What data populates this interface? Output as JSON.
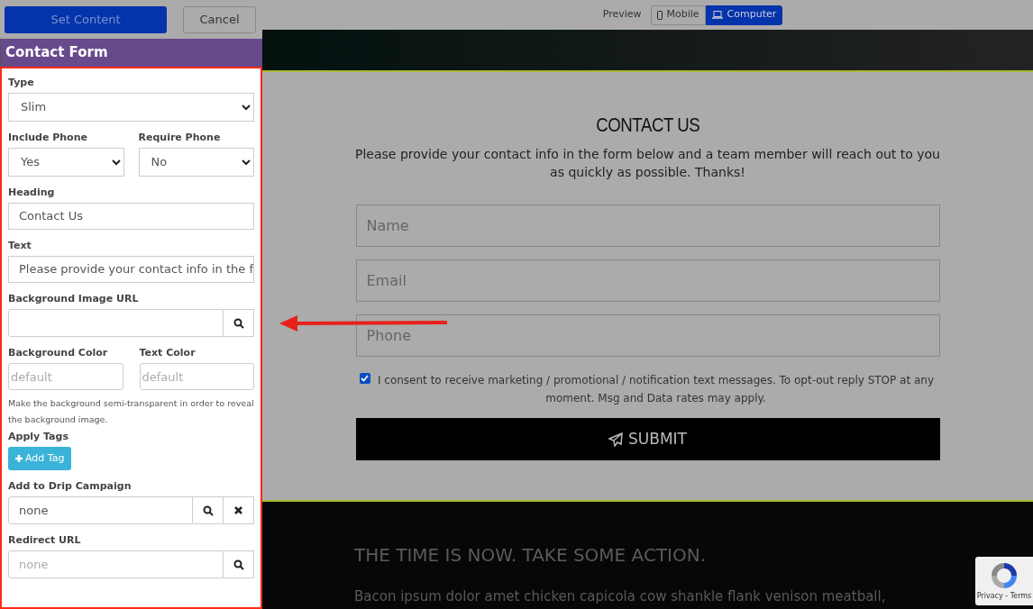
{
  "toolbar": {
    "primary_button": "Set Content",
    "cancel_button": "Cancel"
  },
  "panel": {
    "title": "Contact Form",
    "fields": [
      {
        "kind": "select",
        "label": "Type",
        "value": "Slim"
      },
      {
        "kind": "select_pair",
        "items": [
          {
            "label": "Include Phone",
            "value": "Yes"
          },
          {
            "label": "Require Phone",
            "value": "No"
          }
        ]
      },
      {
        "kind": "text",
        "label": "Heading",
        "value": "Contact Us"
      },
      {
        "kind": "text",
        "label": "Text",
        "value": "Please provide your contact info in the f"
      },
      {
        "kind": "search",
        "label": "Background Image URL"
      },
      {
        "kind": "text_pair",
        "items": [
          {
            "label": "Background Color",
            "placeholder": "default"
          },
          {
            "label": "Text Color",
            "placeholder": "default"
          }
        ]
      },
      {
        "kind": "note",
        "text": "Make the background semi-transparent in order to reveal the background image."
      },
      {
        "kind": "tags",
        "label": "Apply Tags",
        "button": "Add Tag"
      },
      {
        "kind": "search_clear",
        "label": "Add to Drip Campaign",
        "value": "none"
      },
      {
        "kind": "search",
        "label": "Redirect URL",
        "placeholder": "none"
      }
    ]
  },
  "preview": {
    "label": "Preview",
    "modes": [
      {
        "label": "Mobile",
        "kind": "mobile",
        "selected": false
      },
      {
        "label": "Computer",
        "kind": "computer",
        "selected": true
      }
    ],
    "form": {
      "heading": "CONTACT US",
      "text": "Please provide your contact info in the form below and a team member will reach out to you as quickly as possible. Thanks!",
      "inputs": [
        {
          "placeholder": "Name"
        },
        {
          "placeholder": "Email"
        },
        {
          "placeholder": "Phone"
        }
      ],
      "consent": {
        "checked": true,
        "text": "I consent to receive marketing / promotional / notification text messages. To opt-out reply STOP at any moment. Msg and Data rates may apply."
      },
      "submit": "SUBMIT"
    },
    "next_section": {
      "heading": "THE TIME IS NOW. TAKE SOME ACTION.",
      "text": "Bacon ipsum dolor amet chicken capicola cow shankle flank venison meatball,"
    },
    "recaptcha": {
      "links": "Privacy - Terms"
    }
  }
}
